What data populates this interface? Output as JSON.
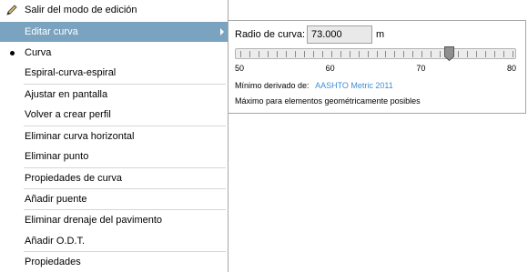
{
  "menu": {
    "exit_edit": "Salir del modo de edición",
    "edit_curve": "Editar curva",
    "curve": "Curva",
    "spiral": "Espiral-curva-espiral",
    "fit_screen": "Ajustar en pantalla",
    "reprofile": "Volver a crear perfil",
    "delete_hcurve": "Eliminar curva horizontal",
    "delete_point": "Eliminar punto",
    "curve_props": "Propiedades de curva",
    "add_bridge": "Añadir puente",
    "delete_drain": "Eliminar drenaje del pavimento",
    "add_odt": "Añadir O.D.T.",
    "properties": "Propiedades"
  },
  "panel": {
    "radius_label": "Radio de curva:",
    "radius_value": "73.000",
    "unit": "m",
    "slider": {
      "min": 50,
      "max": 80,
      "value": 73,
      "tick_labels": [
        "50",
        "60",
        "70",
        "80"
      ]
    },
    "derived_label": "Mínimo derivado de:",
    "derived_link": "AASHTO  Metric  2011",
    "max_note": "Máximo para elementos geométricamente posibles"
  },
  "colors": {
    "selected_bg": "#7aa3bf",
    "link": "#3d8fd6"
  }
}
